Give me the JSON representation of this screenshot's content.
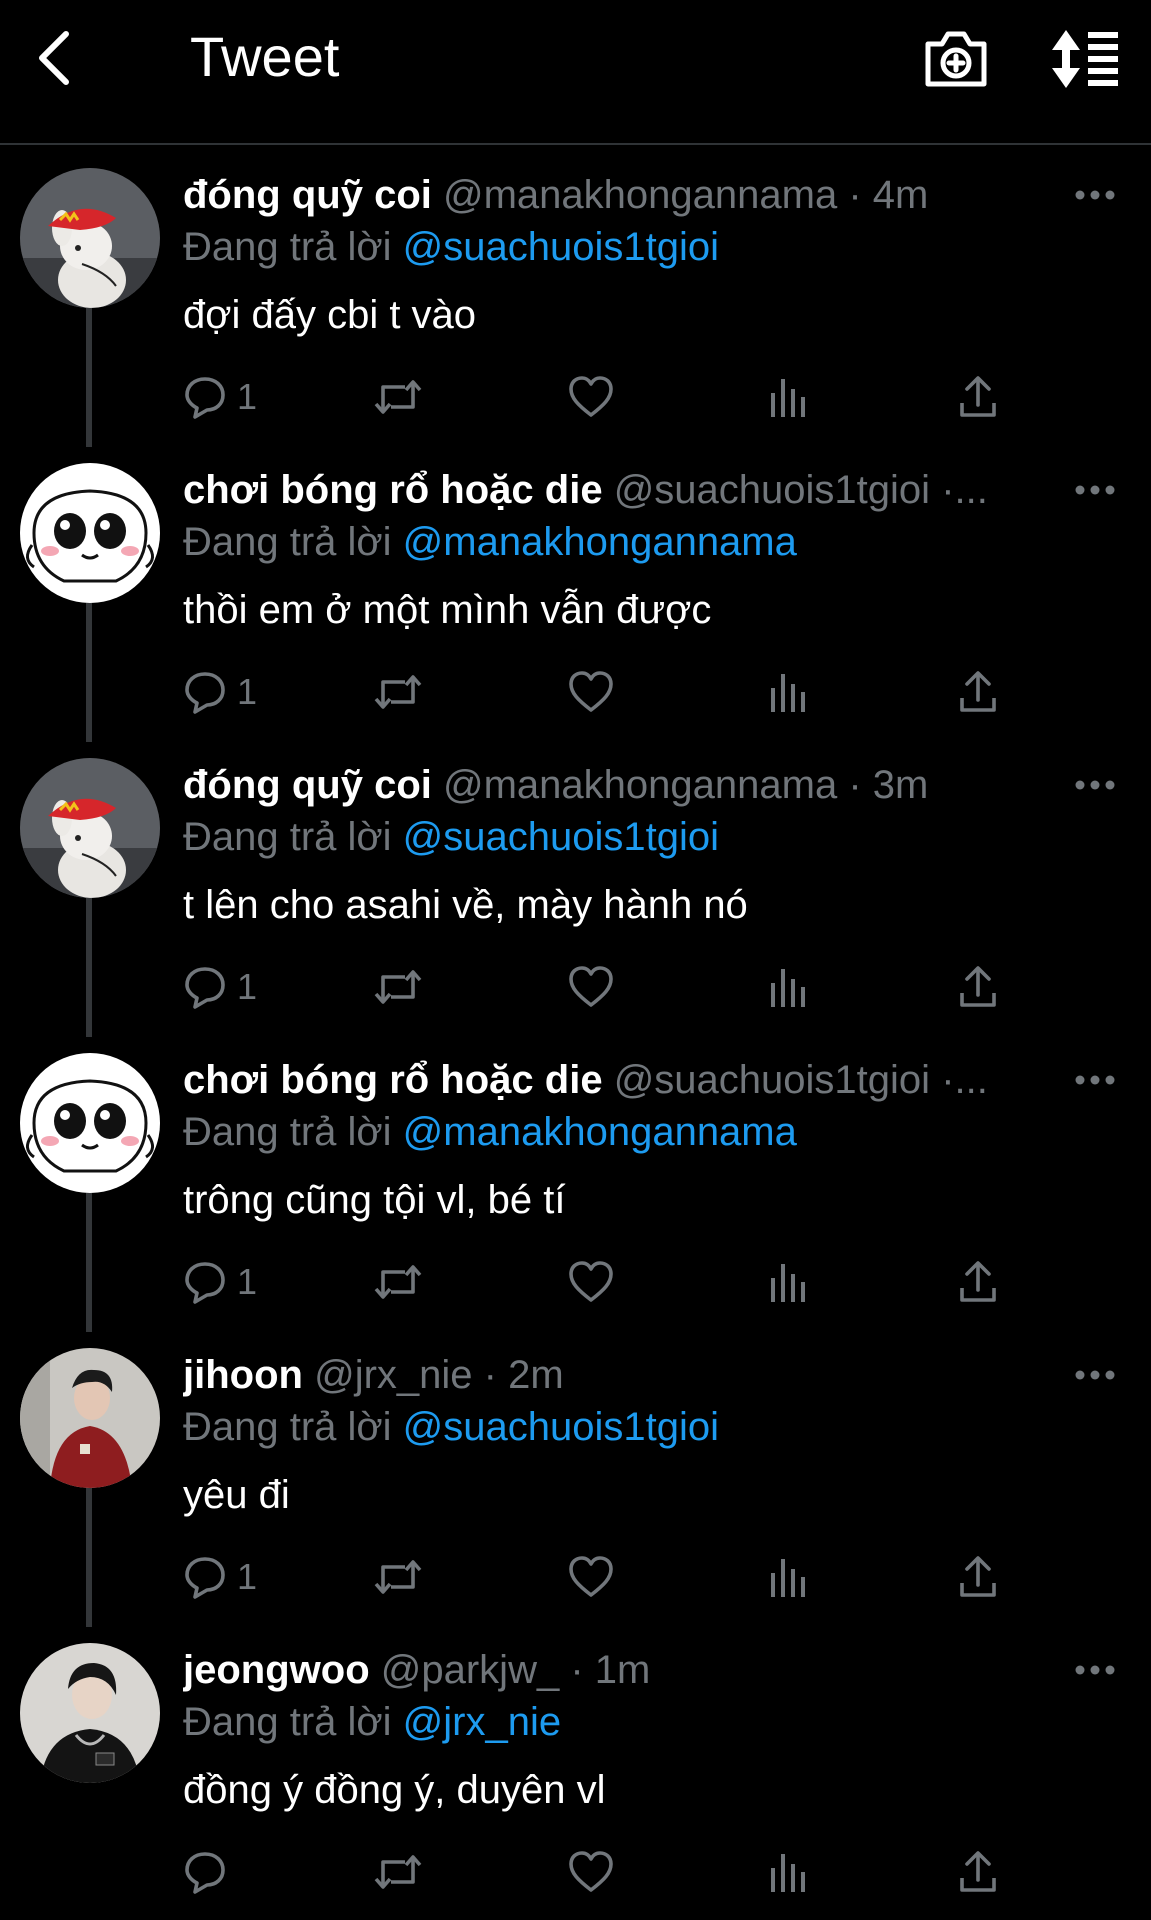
{
  "header": {
    "title": "Tweet",
    "icons": [
      "back-arrow-icon",
      "camera-plus-icon",
      "sort-list-icon"
    ]
  },
  "theme": {
    "background": "#000000",
    "accent": "#1d9bf0",
    "muted": "#71767b",
    "text": "#ffffff"
  },
  "tweets": [
    {
      "display_name": "đóng quỹ coi",
      "handle": "@manakhongannama",
      "separator": "·",
      "time": "4m",
      "reply_prefix": "Đang trả lời",
      "reply_to": "@suachuois1tgioi",
      "text": "đợi đấy cbi t vào",
      "reply_count": "1",
      "avatar": "rabbit"
    },
    {
      "display_name": "chơi bóng rổ hoặc die",
      "handle": "@suachuois1tgioi",
      "separator": "·...",
      "time": "",
      "reply_prefix": "Đang trả lời",
      "reply_to": "@manakhongannama",
      "text": "thồi em ở một mình vẫn được",
      "reply_count": "1",
      "avatar": "cartoon"
    },
    {
      "display_name": "đóng quỹ coi",
      "handle": "@manakhongannama",
      "separator": "·",
      "time": "3m",
      "reply_prefix": "Đang trả lời",
      "reply_to": "@suachuois1tgioi",
      "text": "t lên cho asahi về, mày hành nó",
      "reply_count": "1",
      "avatar": "rabbit"
    },
    {
      "display_name": "chơi bóng rổ hoặc die",
      "handle": "@suachuois1tgioi",
      "separator": "·...",
      "time": "",
      "reply_prefix": "Đang trả lời",
      "reply_to": "@manakhongannama",
      "text": "trông cũng tội vl, bé tí",
      "reply_count": "1",
      "avatar": "cartoon"
    },
    {
      "display_name": "jihoon",
      "handle": "@jrx_nie",
      "separator": "·",
      "time": "2m",
      "reply_prefix": "Đang trả lời",
      "reply_to": "@suachuois1tgioi",
      "text": "yêu đi",
      "reply_count": "1",
      "avatar": "person-red-jacket"
    },
    {
      "display_name": "jeongwoo",
      "handle": "@parkjw_",
      "separator": "·",
      "time": "1m",
      "reply_prefix": "Đang trả lời",
      "reply_to": "@jrx_nie",
      "text": "đồng ý đồng ý, duyên vl",
      "reply_count": "",
      "avatar": "person-dark"
    }
  ]
}
